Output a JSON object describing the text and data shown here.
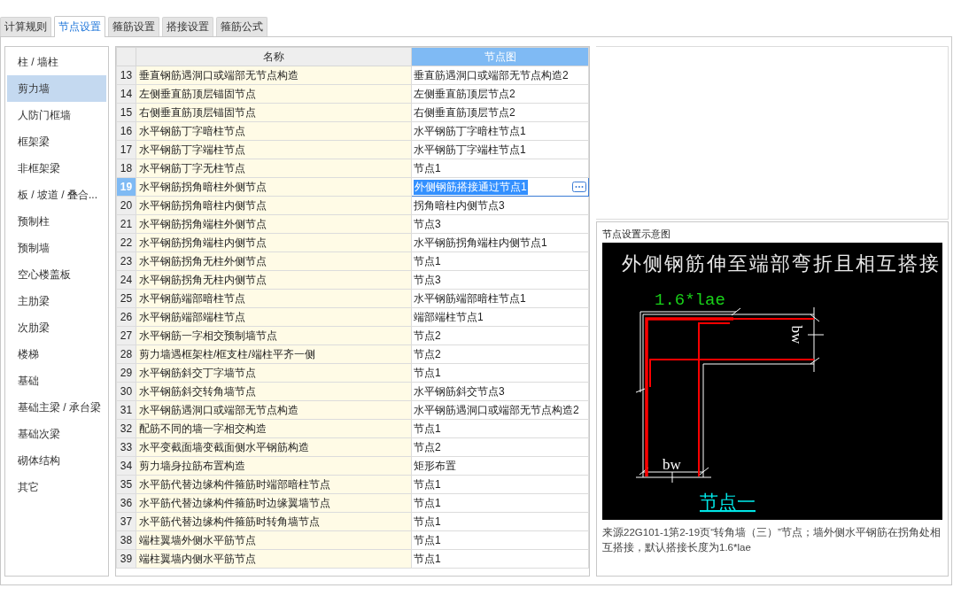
{
  "tabs": [
    {
      "label": "计算规则",
      "selected": false
    },
    {
      "label": "节点设置",
      "selected": true
    },
    {
      "label": "箍筋设置",
      "selected": false
    },
    {
      "label": "搭接设置",
      "selected": false
    },
    {
      "label": "箍筋公式",
      "selected": false
    }
  ],
  "sidebar": {
    "items": [
      {
        "label": "柱 / 墙柱",
        "selected": false
      },
      {
        "label": "剪力墙",
        "selected": true
      },
      {
        "label": "人防门框墙",
        "selected": false
      },
      {
        "label": "框架梁",
        "selected": false
      },
      {
        "label": "非框架梁",
        "selected": false
      },
      {
        "label": "板 / 坡道 / 叠合...",
        "selected": false
      },
      {
        "label": "预制柱",
        "selected": false
      },
      {
        "label": "预制墙",
        "selected": false
      },
      {
        "label": "空心楼盖板",
        "selected": false
      },
      {
        "label": "主肋梁",
        "selected": false
      },
      {
        "label": "次肋梁",
        "selected": false
      },
      {
        "label": "楼梯",
        "selected": false
      },
      {
        "label": "基础",
        "selected": false
      },
      {
        "label": "基础主梁 / 承台梁",
        "selected": false
      },
      {
        "label": "基础次梁",
        "selected": false
      },
      {
        "label": "砌体结构",
        "selected": false
      },
      {
        "label": "其它",
        "selected": false
      }
    ]
  },
  "table": {
    "columns": [
      {
        "label": "名称",
        "selected": false
      },
      {
        "label": "节点图",
        "selected": true
      }
    ],
    "rows": [
      {
        "number": "13",
        "name": "垂直钢筋遇洞口或端部无节点构造",
        "node": "垂直筋遇洞口或端部无节点构造2",
        "selected": false
      },
      {
        "number": "14",
        "name": "左侧垂直筋顶层锚固节点",
        "node": "左侧垂直筋顶层节点2",
        "selected": false
      },
      {
        "number": "15",
        "name": "右侧垂直筋顶层锚固节点",
        "node": "右侧垂直筋顶层节点2",
        "selected": false
      },
      {
        "number": "16",
        "name": "水平钢筋丁字暗柱节点",
        "node": "水平钢筋丁字暗柱节点1",
        "selected": false
      },
      {
        "number": "17",
        "name": "水平钢筋丁字端柱节点",
        "node": "水平钢筋丁字端柱节点1",
        "selected": false
      },
      {
        "number": "18",
        "name": "水平钢筋丁字无柱节点",
        "node": "节点1",
        "selected": false
      },
      {
        "number": "19",
        "name": "水平钢筋拐角暗柱外侧节点",
        "node": "外侧钢筋搭接通过节点1",
        "selected": true
      },
      {
        "number": "20",
        "name": "水平钢筋拐角暗柱内侧节点",
        "node": "拐角暗柱内侧节点3",
        "selected": false
      },
      {
        "number": "21",
        "name": "水平钢筋拐角端柱外侧节点",
        "node": "节点3",
        "selected": false
      },
      {
        "number": "22",
        "name": "水平钢筋拐角端柱内侧节点",
        "node": "水平钢筋拐角端柱内侧节点1",
        "selected": false
      },
      {
        "number": "23",
        "name": "水平钢筋拐角无柱外侧节点",
        "node": "节点1",
        "selected": false
      },
      {
        "number": "24",
        "name": "水平钢筋拐角无柱内侧节点",
        "node": "节点3",
        "selected": false
      },
      {
        "number": "25",
        "name": "水平钢筋端部暗柱节点",
        "node": "水平钢筋端部暗柱节点1",
        "selected": false
      },
      {
        "number": "26",
        "name": "水平钢筋端部端柱节点",
        "node": "端部端柱节点1",
        "selected": false
      },
      {
        "number": "27",
        "name": "水平钢筋一字相交预制墙节点",
        "node": "节点2",
        "selected": false
      },
      {
        "number": "28",
        "name": "剪力墙遇框架柱/框支柱/端柱平齐一侧",
        "node": "节点2",
        "selected": false
      },
      {
        "number": "29",
        "name": "水平钢筋斜交丁字墙节点",
        "node": "节点1",
        "selected": false
      },
      {
        "number": "30",
        "name": "水平钢筋斜交转角墙节点",
        "node": "水平钢筋斜交节点3",
        "selected": false
      },
      {
        "number": "31",
        "name": "水平钢筋遇洞口或端部无节点构造",
        "node": "水平钢筋遇洞口或端部无节点构造2",
        "selected": false
      },
      {
        "number": "32",
        "name": "配筋不同的墙一字相交构造",
        "node": "节点1",
        "selected": false
      },
      {
        "number": "33",
        "name": "水平变截面墙变截面侧水平钢筋构造",
        "node": "节点2",
        "selected": false
      },
      {
        "number": "34",
        "name": "剪力墙身拉筋布置构造",
        "node": "矩形布置",
        "selected": false
      },
      {
        "number": "35",
        "name": "水平筋代替边缘构件箍筋时端部暗柱节点",
        "node": "节点1",
        "selected": false
      },
      {
        "number": "36",
        "name": "水平筋代替边缘构件箍筋时边缘翼墙节点",
        "node": "节点1",
        "selected": false
      },
      {
        "number": "37",
        "name": "水平筋代替边缘构件箍筋时转角墙节点",
        "node": "节点1",
        "selected": false
      },
      {
        "number": "38",
        "name": "端柱翼墙外侧水平筋节点",
        "node": "节点1",
        "selected": false
      },
      {
        "number": "39",
        "name": "端柱翼墙内侧水平筋节点",
        "node": "节点1",
        "selected": false
      }
    ]
  },
  "preview": {
    "title": "节点设置示意图",
    "diagram": {
      "heading": "外侧钢筋伸至端部弯折且相互搭接",
      "length_label": "1.6*lae",
      "width_label_right": "bw",
      "width_label_bottom": "bw",
      "node_name": "节点一"
    },
    "caption": "来源22G101-1第2-19页“转角墙（三）”节点；墙外侧水平钢筋在拐角处相互搭接，默认搭接长度为1.6*lae"
  }
}
